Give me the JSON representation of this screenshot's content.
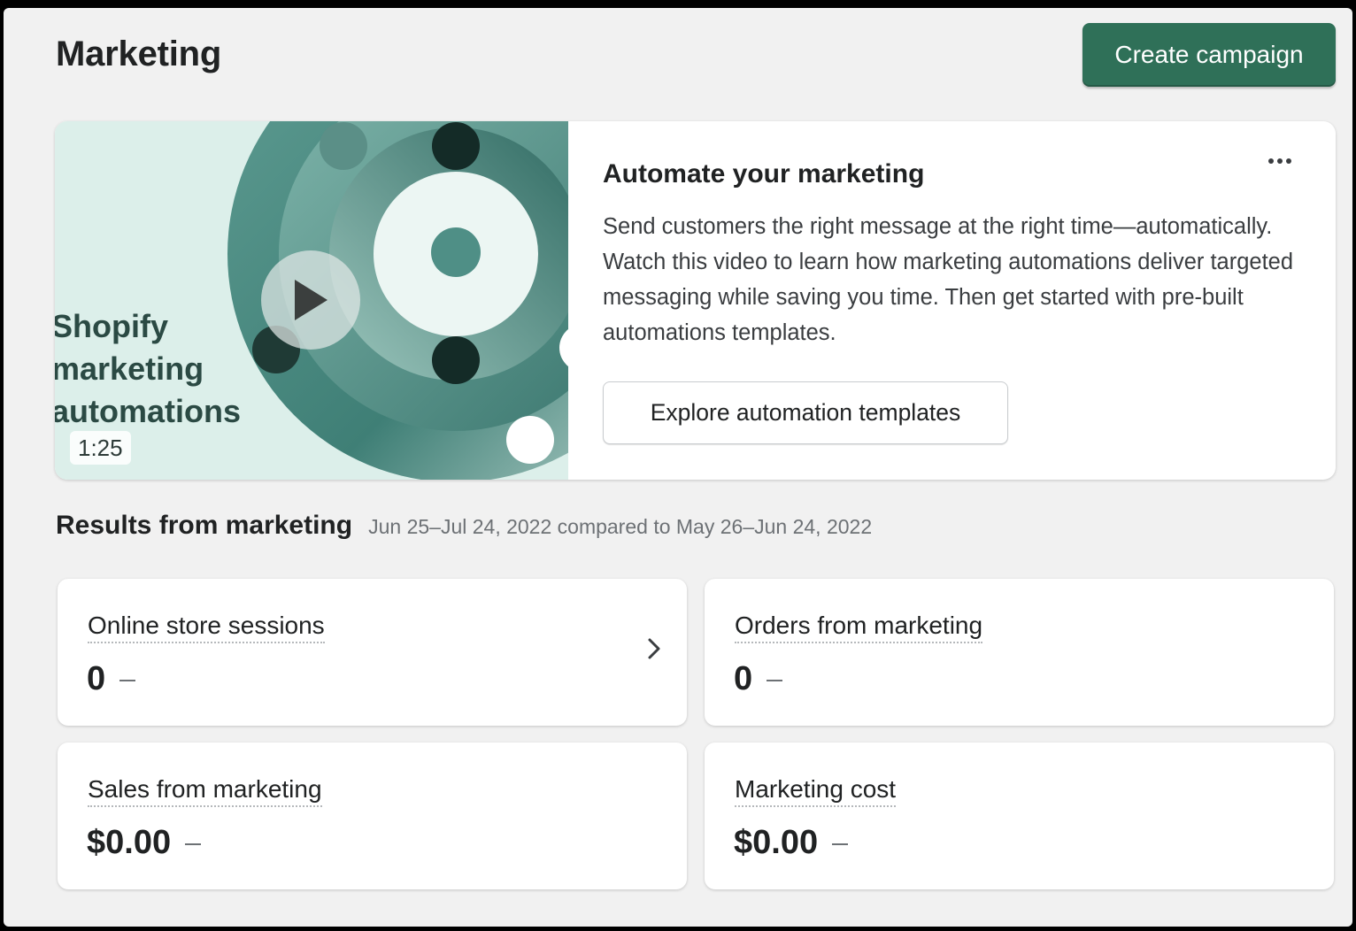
{
  "page": {
    "title": "Marketing",
    "create_campaign_label": "Create campaign"
  },
  "promo": {
    "video_title": "Shopify\nmarketing\nautomations",
    "duration": "1:25",
    "heading": "Automate your marketing",
    "body": "Send customers the right message at the right time—automatically. Watch this video to learn how marketing automations deliver targeted messaging while saving you time. Then get started with pre-built automations templates.",
    "button_label": "Explore automation templates",
    "more_icon": "horizontal-dots-icon"
  },
  "results": {
    "title": "Results from marketing",
    "date_range": "Jun 25–Jul 24, 2022 compared to May 26–Jun 24, 2022",
    "metrics": [
      {
        "label": "Online store sessions",
        "value": "0",
        "has_chevron": true
      },
      {
        "label": "Orders from marketing",
        "value": "0",
        "has_chevron": false
      },
      {
        "label": "Sales from marketing",
        "value": "$0.00",
        "has_chevron": false
      },
      {
        "label": "Marketing cost",
        "value": "$0.00",
        "has_chevron": false
      }
    ]
  },
  "colors": {
    "primary": "#2f7058",
    "page_bg": "#f1f1f1",
    "card_bg": "#ffffff",
    "thumb_bg": "#dcefea",
    "thumb_accent": "#4f8f86",
    "text_subdued": "#6d7175"
  }
}
